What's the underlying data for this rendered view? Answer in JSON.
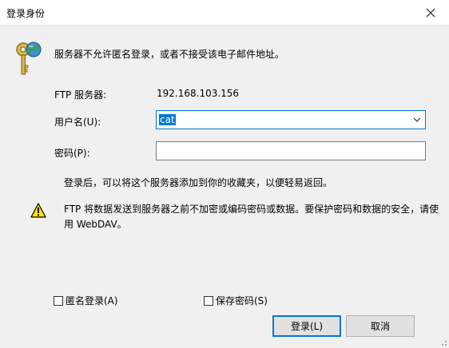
{
  "window": {
    "title": "登录身份",
    "close_icon": "close-icon"
  },
  "info": {
    "icon": "key-globe-icon",
    "message": "服务器不允许匿名登录，或者不接受该电子邮件地址。"
  },
  "form": {
    "server_label": "FTP 服务器:",
    "server_value": "192.168.103.156",
    "username_label": "用户名(U):",
    "username_value": "cat",
    "password_label": "密码(P):",
    "password_value": ""
  },
  "hint": "登录后，可以将这个服务器添加到你的收藏夹，以便轻易返回。",
  "warning": {
    "icon": "warning-icon",
    "text": "FTP 将数据发送到服务器之前不加密或编码密码或数据。要保护密码和数据的安全，请使用 WebDAV。"
  },
  "options": {
    "anonymous_label": "匿名登录(A)",
    "anonymous_checked": false,
    "save_password_label": "保存密码(S)",
    "save_password_checked": false
  },
  "buttons": {
    "login_label": "登录(L)",
    "cancel_label": "取消"
  },
  "colors": {
    "accent": "#0078d7",
    "warning_fill": "#ffe100"
  }
}
